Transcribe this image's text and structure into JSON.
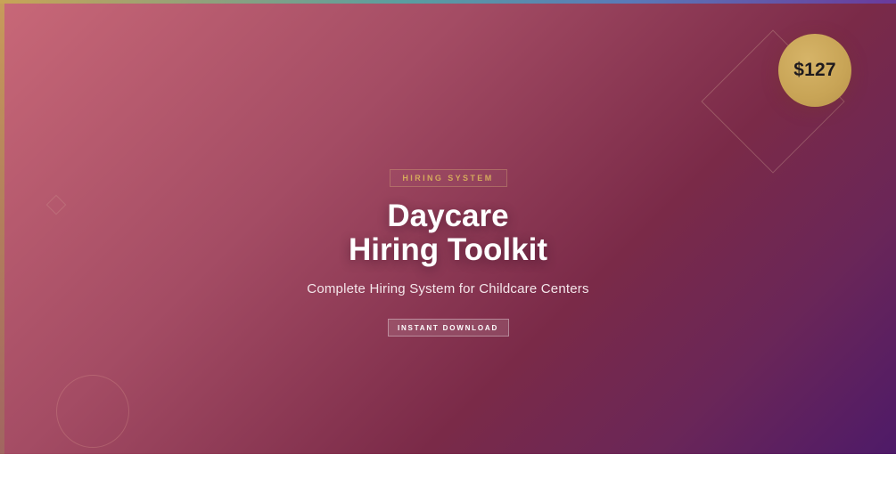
{
  "hero": {
    "price": "$127",
    "tag": "HIRING SYSTEM",
    "title_line1": "Daycare",
    "title_line2": "Hiring Toolkit",
    "subtitle": "Complete Hiring System for Childcare Centers",
    "cta_label": "INSTANT DOWNLOAD"
  },
  "colors": {
    "accent_gold": "#c8a456",
    "gradient_start": "#c86878",
    "gradient_mid": "#7a2a48",
    "gradient_end": "#4e1a68",
    "page_background": "#ffffff"
  }
}
